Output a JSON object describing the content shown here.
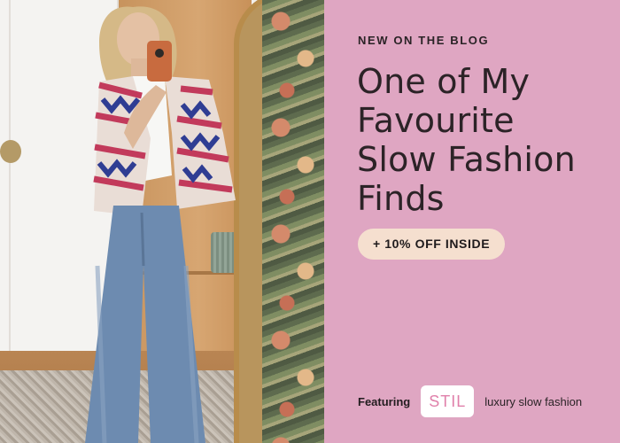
{
  "banner": {
    "eyebrow": "NEW ON THE BLOG",
    "headline_lines": [
      "One of My",
      "Favourite",
      "Slow Fashion",
      "Finds"
    ],
    "promo_pill": "+ 10% OFF INSIDE",
    "featuring_label": "Featuring",
    "brand_logo_text": "STIL",
    "tagline": "luxury slow fashion"
  },
  "colors": {
    "background": "#dfa6c2",
    "text": "#2c2327",
    "pill_background": "#f5dfcf",
    "logo_text": "#e080aa"
  },
  "icons": [
    "phone-icon"
  ]
}
